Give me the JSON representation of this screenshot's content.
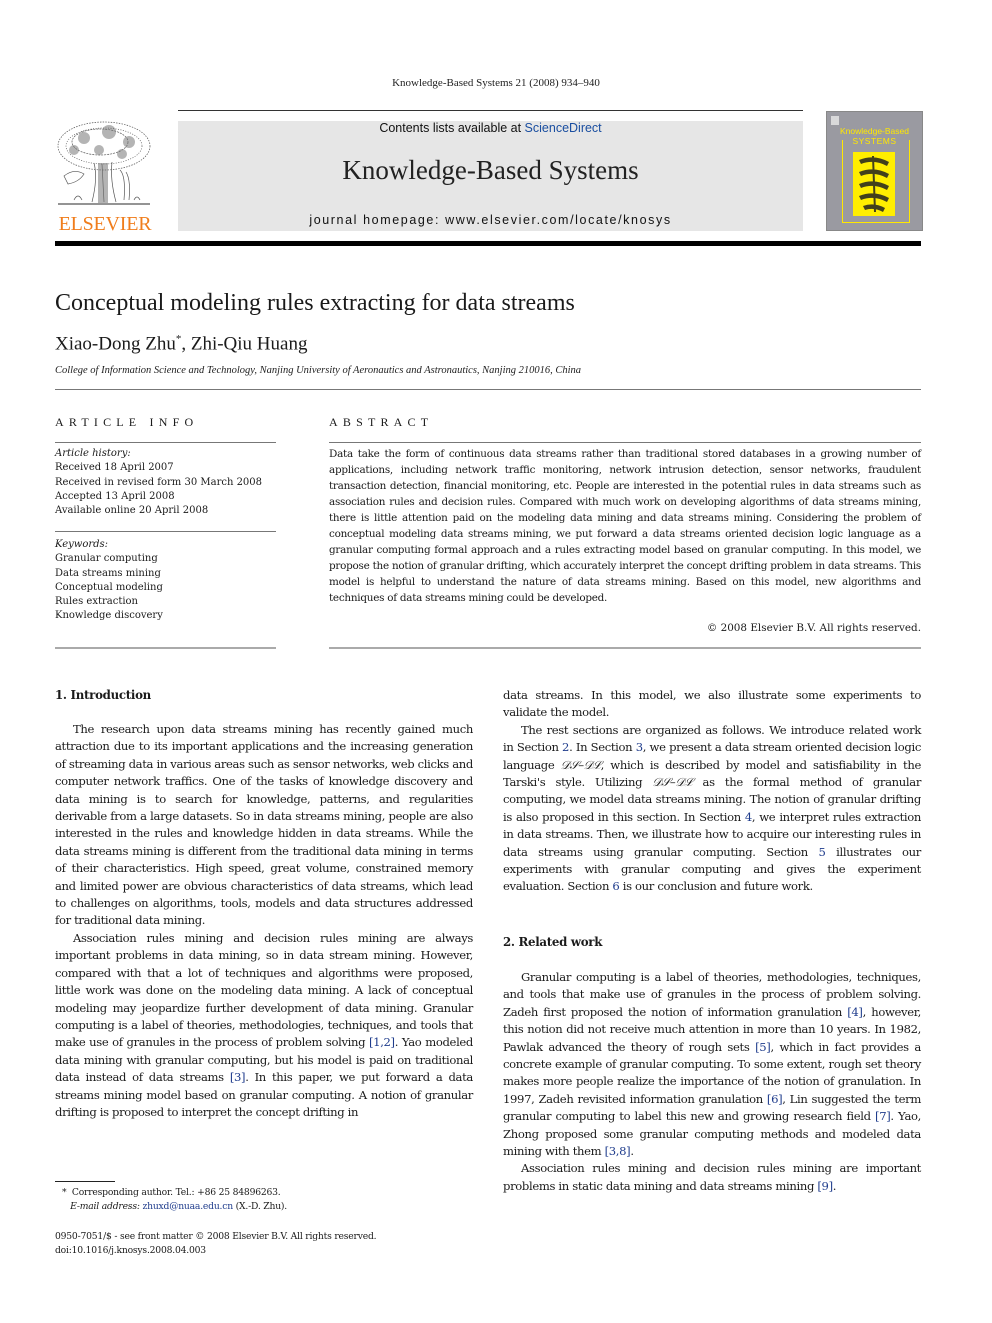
{
  "running_head": "Knowledge-Based Systems 21 (2008) 934–940",
  "masthead": {
    "publisher_logo_text": "ELSEVIER",
    "contents_prefix": "Contents lists available at ",
    "contents_link": "ScienceDirect",
    "journal_title": "Knowledge-Based Systems",
    "homepage": "journal homepage: www.elsevier.com/locate/knosys",
    "cover_title_line1": "Knowledge-Based",
    "cover_title_line2": "SYSTEMS"
  },
  "article": {
    "title": "Conceptual modeling rules extracting for data streams",
    "authors": [
      {
        "name": "Xiao-Dong Zhu",
        "mark": "*"
      },
      {
        "name": "Zhi-Qiu Huang",
        "mark": ""
      }
    ],
    "author_separator": ", ",
    "affiliation": "College of Information Science and Technology, Nanjing University of Aeronautics and Astronautics, Nanjing 210016, China"
  },
  "article_info": {
    "heading": "ARTICLE INFO",
    "history_label": "Article history:",
    "history": [
      "Received 18 April 2007",
      "Received in revised form 30 March 2008",
      "Accepted 13 April 2008",
      "Available online 20 April 2008"
    ],
    "keywords_label": "Keywords:",
    "keywords": [
      "Granular computing",
      "Data streams mining",
      "Conceptual modeling",
      "Rules extraction",
      "Knowledge discovery"
    ]
  },
  "abstract": {
    "heading": "ABSTRACT",
    "text": "Data take the form of continuous data streams rather than traditional stored databases in a growing number of applications, including network traffic monitoring, network intrusion detection, sensor networks, fraudulent transaction detection, financial monitoring, etc. People are interested in the potential rules in data streams such as association rules and decision rules. Compared with much work on developing algorithms of data streams mining, there is little attention paid on the modeling data mining and data streams mining. Considering the problem of conceptual modeling data streams mining, we put forward a data streams oriented decision logic language as a granular computing formal approach and a rules extracting model based on granular computing. In this model, we propose the notion of granular drifting, which accurately interpret the concept drifting problem in data streams. This model is helpful to understand the nature of data streams mining. Based on this model, new algorithms and techniques of data streams mining could be developed.",
    "copyright": "© 2008 Elsevier B.V. All rights reserved."
  },
  "sections": {
    "intro_heading": "1. Introduction",
    "intro_p1": "The research upon data streams mining has recently gained much attraction due to its important applications and the increasing generation of streaming data in various areas such as sensor networks, web clicks and computer network traffics. One of the tasks of knowledge discovery and data mining is to search for knowledge, patterns, and regularities derivable from a large datasets. So in data streams mining, people are also interested in the rules and knowledge hidden in data streams. While the data streams mining is different from the traditional data mining in terms of their characteristics. High speed, great volume, constrained memory and limited power are obvious characteristics of data streams, which lead to challenges on algorithms, tools, models and data structures addressed for traditional data mining.",
    "intro_p2_a": "Association rules mining and decision rules mining are always important problems in data mining, so in data stream mining. However, compared with that a lot of techniques and algorithms were proposed, little work was done on the modeling data mining. A lack of conceptual modeling may jeopardize further development of data mining. Granular computing is a label of theories, methodologies, techniques, and tools that make use of granules in the process of problem solving ",
    "intro_p2_ref1": "[1,2]",
    "intro_p2_b": ". Yao modeled data mining with granular computing, but his model is paid on traditional data instead of data streams ",
    "intro_p2_ref2": "[3]",
    "intro_p2_c": ". In this paper, we put forward a data streams mining model based on granular computing. A notion of granular drifting is proposed to interpret the concept drifting in data streams. In this model, we also illustrate some experiments to validate the model.",
    "intro_p2_left": "Association rules mining and decision rules mining are always important problems in data mining, so in data stream mining. However, compared with that a lot of techniques and algorithms were proposed, little work was done on the modeling data mining. A lack of conceptual modeling may jeopardize further development of data mining. Granular computing is a label of theories, methodologies, techniques, and tools that make use of granules in the process of problem solving",
    "intro_p2_cont": "data streams. In this model, we also illustrate some experiments to validate the model.",
    "intro_p3": {
      "a": "The rest sections are organized as follows. We introduce related work in Section ",
      "s2": "2",
      "b": ". In Section ",
      "s3": "3",
      "c": ", we present a data stream oriented decision logic language ",
      "dsdl": "𝒟𝒮–𝒟ℒ",
      "d": ", which is described by model and satisfiability in the Tarski's style. Utilizing ",
      "e": " as the formal method of granular computing, we model data streams mining. The notion of granular drifting is also proposed in this section. In Section ",
      "s4": "4",
      "f": ", we interpret rules extraction in data streams. Then, we illustrate how to acquire our interesting rules in data streams using granular computing. Section ",
      "s5": "5",
      "g": " illustrates our experiments with granular computing and gives the experiment evaluation. Section ",
      "s6": "6",
      "h": " is our conclusion and future work."
    },
    "related_heading": "2. Related work",
    "related_p1": {
      "a": "Granular computing is a label of theories, methodologies, techniques, and tools that make use of granules in the process of problem solving. Zadeh first proposed the notion of information granulation ",
      "r4": "[4]",
      "b": ", however, this notion did not receive much attention in more than 10 years. In 1982, Pawlak advanced the theory of rough sets ",
      "r5": "[5]",
      "c": ", which in fact provides a concrete example of granular computing. To some extent, rough set theory makes more people realize the importance of the notion of granulation. In 1997, Zadeh revisited information granulation ",
      "r6": "[6]",
      "d": ", Lin suggested the term granular computing to label this new and growing research field ",
      "r7": "[7]",
      "e": ". Yao, Zhong proposed some granular computing methods and modeled data mining with them ",
      "r38": "[3,8]",
      "f": "."
    },
    "related_p2": {
      "a": "Association rules mining and decision rules mining are important problems in static data mining and data streams mining ",
      "r9": "[9]",
      "b": "."
    }
  },
  "footnotes": {
    "mark": "*",
    "corresponding": "Corresponding author. Tel.: +86 25 84896263.",
    "email_label": "E-mail address:",
    "email": "zhuxd@nuaa.edu.cn",
    "email_suffix": " (X.-D. Zhu).",
    "front_matter": "0950-7051/$ - see front matter © 2008 Elsevier B.V. All rights reserved.",
    "doi": "doi:10.1016/j.knosys.2008.04.003"
  },
  "colors": {
    "link": "#1f3c8c",
    "elsevier_orange": "#f07d1c",
    "masthead_bg": "#e6e6e6",
    "cover_bg": "#9a9aa1",
    "cover_accent": "#ffe800"
  }
}
